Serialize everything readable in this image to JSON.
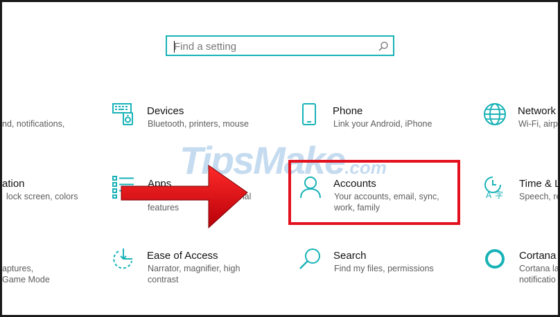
{
  "search": {
    "placeholder": "Find a setting"
  },
  "tiles": [
    {
      "title": "",
      "desc": [
        "nd, notifications,"
      ]
    },
    {
      "title": "Devices",
      "desc": [
        "Bluetooth, printers, mouse"
      ]
    },
    {
      "title": "Phone",
      "desc": [
        "Link your Android, iPhone"
      ]
    },
    {
      "title": "Network",
      "desc": [
        "Wi-Fi, airpl"
      ]
    },
    {
      "title": "ation",
      "desc": [
        "lock screen, colors"
      ]
    },
    {
      "title": "Apps",
      "desc": [
        "Uninstall, defaults, optional",
        "features"
      ]
    },
    {
      "title": "Accounts",
      "desc": [
        "Your accounts, email, sync,",
        "work, family"
      ]
    },
    {
      "title": "Time & La",
      "desc": [
        "Speech, reg"
      ]
    },
    {
      "title": "",
      "desc": [
        "aptures,",
        "Game Mode"
      ]
    },
    {
      "title": "Ease of Access",
      "desc": [
        "Narrator, magnifier, high",
        "contrast"
      ]
    },
    {
      "title": "Search",
      "desc": [
        "Find my files, permissions"
      ]
    },
    {
      "title": "Cortana",
      "desc": [
        "Cortana la",
        "notificatio"
      ]
    }
  ],
  "watermark": {
    "text": "TipsMake",
    "suffix": ".com"
  },
  "colors": {
    "accent": "#17b2b7",
    "highlight": "#e3101e",
    "arrow": "#e8101c"
  },
  "icons": [
    "search-icon",
    "devices-icon",
    "phone-icon",
    "network-globe-icon",
    "apps-icon",
    "accounts-person-icon",
    "time-language-icon",
    "ease-of-access-icon",
    "search-magnifier-icon",
    "cortana-icon"
  ]
}
